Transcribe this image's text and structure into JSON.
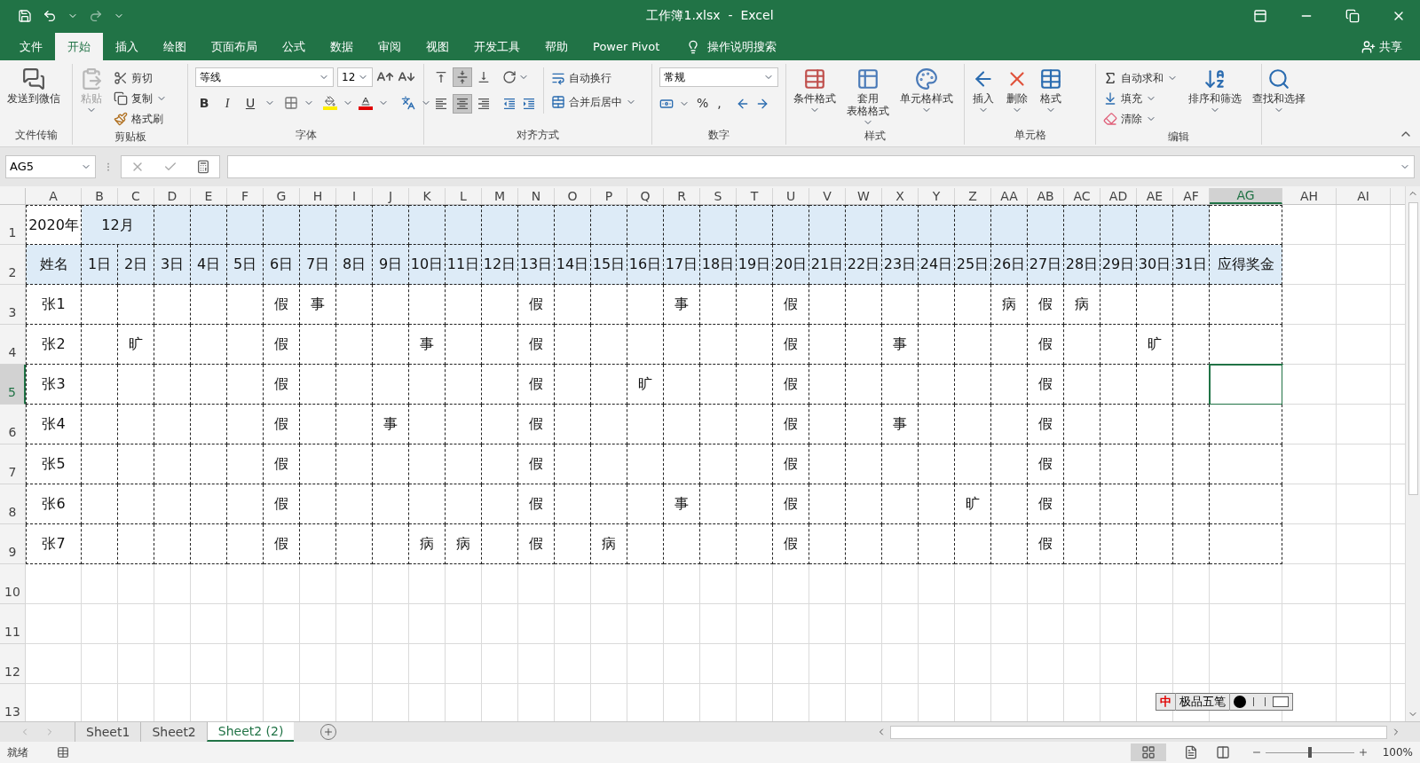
{
  "window": {
    "title": "工作簿1.xlsx  -  Excel"
  },
  "menu_tabs": [
    {
      "label": "文件",
      "selected": false
    },
    {
      "label": "开始",
      "selected": true
    },
    {
      "label": "插入",
      "selected": false
    },
    {
      "label": "绘图",
      "selected": false
    },
    {
      "label": "页面布局",
      "selected": false
    },
    {
      "label": "公式",
      "selected": false
    },
    {
      "label": "数据",
      "selected": false
    },
    {
      "label": "审阅",
      "selected": false
    },
    {
      "label": "视图",
      "selected": false
    },
    {
      "label": "开发工具",
      "selected": false
    },
    {
      "label": "帮助",
      "selected": false
    },
    {
      "label": "Power Pivot",
      "selected": false
    }
  ],
  "tell_me": "操作说明搜索",
  "share": "共享",
  "ribbon": {
    "send": {
      "label": "发送到微信",
      "group": "文件传输"
    },
    "clipboard": {
      "group": "剪贴板",
      "paste": {
        "label": "粘贴",
        "disabled": true
      },
      "items": [
        {
          "label": "剪切"
        },
        {
          "label": "复制"
        },
        {
          "label": "格式刷"
        }
      ]
    },
    "font": {
      "group": "字体",
      "name": "等线",
      "size": "12",
      "styles": [
        "B",
        "I",
        "U"
      ]
    },
    "alignment": {
      "group": "对齐方式",
      "vertical": [
        {
          "selected": false
        },
        {
          "selected": true
        },
        {
          "selected": false
        }
      ],
      "horizontal": [
        {
          "selected": false
        },
        {
          "selected": true
        },
        {
          "selected": false
        }
      ],
      "wrap": "自动换行",
      "merge": "合并后居中"
    },
    "number": {
      "group": "数字",
      "format": "常规",
      "symbols": [
        "%",
        ","
      ]
    },
    "styles": {
      "group": "样式",
      "items": [
        {
          "lines": [
            "条件格式"
          ]
        },
        {
          "lines": [
            "套用",
            "表格格式"
          ]
        },
        {
          "lines": [
            "单元格样式"
          ]
        }
      ]
    },
    "cells": {
      "group": "单元格",
      "items": [
        {
          "label": "插入"
        },
        {
          "label": "删除"
        },
        {
          "label": "格式"
        }
      ]
    },
    "editing": {
      "group": "编辑",
      "small": [
        {
          "label": "自动求和"
        },
        {
          "label": "填充"
        },
        {
          "label": "清除"
        }
      ],
      "large": [
        {
          "label": "排序和筛选"
        },
        {
          "label": "查找和选择"
        }
      ]
    }
  },
  "name_box": "AG5",
  "columns": [
    {
      "label": "A",
      "selected": false
    },
    {
      "label": "B",
      "selected": false
    },
    {
      "label": "C",
      "selected": false
    },
    {
      "label": "D",
      "selected": false
    },
    {
      "label": "E",
      "selected": false
    },
    {
      "label": "F",
      "selected": false
    },
    {
      "label": "G",
      "selected": false
    },
    {
      "label": "H",
      "selected": false
    },
    {
      "label": "I",
      "selected": false
    },
    {
      "label": "J",
      "selected": false
    },
    {
      "label": "K",
      "selected": false
    },
    {
      "label": "L",
      "selected": false
    },
    {
      "label": "M",
      "selected": false
    },
    {
      "label": "N",
      "selected": false
    },
    {
      "label": "O",
      "selected": false
    },
    {
      "label": "P",
      "selected": false
    },
    {
      "label": "Q",
      "selected": false
    },
    {
      "label": "R",
      "selected": false
    },
    {
      "label": "S",
      "selected": false
    },
    {
      "label": "T",
      "selected": false
    },
    {
      "label": "U",
      "selected": false
    },
    {
      "label": "V",
      "selected": false
    },
    {
      "label": "W",
      "selected": false
    },
    {
      "label": "X",
      "selected": false
    },
    {
      "label": "Y",
      "selected": false
    },
    {
      "label": "Z",
      "selected": false
    },
    {
      "label": "AA",
      "selected": false
    },
    {
      "label": "AB",
      "selected": false
    },
    {
      "label": "AC",
      "selected": false
    },
    {
      "label": "AD",
      "selected": false
    },
    {
      "label": "AE",
      "selected": false
    },
    {
      "label": "AF",
      "selected": false
    },
    {
      "label": "AG",
      "selected": true
    },
    {
      "label": "AH",
      "selected": false
    },
    {
      "label": "AI",
      "selected": false
    }
  ],
  "rows": [
    {
      "number": "1",
      "selected": false,
      "kind": "title",
      "cells": [
        {
          "text": "2020年",
          "shaded": false,
          "merged": false
        },
        {
          "text": "12月",
          "shaded": true,
          "merged": true
        },
        {
          "shaded": true,
          "merged": false
        },
        {
          "shaded": true,
          "merged": false
        },
        {
          "shaded": true,
          "merged": false
        },
        {
          "shaded": true,
          "merged": false
        },
        {
          "shaded": true,
          "merged": false
        },
        {
          "shaded": true,
          "merged": false
        },
        {
          "shaded": true,
          "merged": false
        },
        {
          "shaded": true,
          "merged": false
        },
        {
          "shaded": true,
          "merged": false
        },
        {
          "shaded": true,
          "merged": false
        },
        {
          "shaded": true,
          "merged": false
        },
        {
          "shaded": true,
          "merged": false
        },
        {
          "shaded": true,
          "merged": false
        },
        {
          "shaded": true,
          "merged": false
        },
        {
          "shaded": true,
          "merged": false
        },
        {
          "shaded": true,
          "merged": false
        },
        {
          "shaded": true,
          "merged": false
        },
        {
          "shaded": true,
          "merged": false
        },
        {
          "shaded": true,
          "merged": false
        },
        {
          "shaded": true,
          "merged": false
        },
        {
          "shaded": true,
          "merged": false
        },
        {
          "shaded": true,
          "merged": false
        },
        {
          "shaded": true,
          "merged": false
        },
        {
          "shaded": true,
          "merged": false
        },
        {
          "shaded": true,
          "merged": false
        },
        {
          "shaded": true,
          "merged": false
        },
        {
          "shaded": true,
          "merged": false
        },
        {
          "shaded": true,
          "merged": false
        },
        {
          "shaded": true,
          "merged": false
        },
        {
          "shaded": false,
          "merged": false
        }
      ]
    },
    {
      "number": "2",
      "selected": false,
      "kind": "table",
      "shaded": true,
      "cells": [
        {
          "text": "姓名"
        },
        {
          "text": "1日"
        },
        {
          "text": "2日"
        },
        {
          "text": "3日"
        },
        {
          "text": "4日"
        },
        {
          "text": "5日"
        },
        {
          "text": "6日"
        },
        {
          "text": "7日"
        },
        {
          "text": "8日"
        },
        {
          "text": "9日"
        },
        {
          "text": "10日"
        },
        {
          "text": "11日"
        },
        {
          "text": "12日"
        },
        {
          "text": "13日"
        },
        {
          "text": "14日"
        },
        {
          "text": "15日"
        },
        {
          "text": "16日"
        },
        {
          "text": "17日"
        },
        {
          "text": "18日"
        },
        {
          "text": "19日"
        },
        {
          "text": "20日"
        },
        {
          "text": "21日"
        },
        {
          "text": "22日"
        },
        {
          "text": "23日"
        },
        {
          "text": "24日"
        },
        {
          "text": "25日"
        },
        {
          "text": "26日"
        },
        {
          "text": "27日"
        },
        {
          "text": "28日"
        },
        {
          "text": "29日"
        },
        {
          "text": "30日"
        },
        {
          "text": "31日"
        },
        {
          "text": "应得奖金"
        }
      ]
    },
    {
      "number": "3",
      "selected": false,
      "kind": "table",
      "shaded": false,
      "cells": [
        {
          "text": "张1"
        },
        {},
        {},
        {},
        {},
        {},
        {
          "text": "假"
        },
        {
          "text": "事"
        },
        {},
        {},
        {},
        {},
        {},
        {
          "text": "假"
        },
        {},
        {},
        {},
        {
          "text": "事"
        },
        {},
        {},
        {
          "text": "假"
        },
        {},
        {},
        {},
        {},
        {},
        {
          "text": "病"
        },
        {
          "text": "假"
        },
        {
          "text": "病"
        },
        {},
        {},
        {},
        {}
      ]
    },
    {
      "number": "4",
      "selected": false,
      "kind": "table",
      "shaded": false,
      "cells": [
        {
          "text": "张2"
        },
        {},
        {
          "text": "旷"
        },
        {},
        {},
        {},
        {
          "text": "假"
        },
        {},
        {},
        {},
        {
          "text": "事"
        },
        {},
        {},
        {
          "text": "假"
        },
        {},
        {},
        {},
        {},
        {},
        {},
        {
          "text": "假"
        },
        {},
        {},
        {
          "text": "事"
        },
        {},
        {},
        {},
        {
          "text": "假"
        },
        {},
        {},
        {
          "text": "旷"
        },
        {},
        {}
      ]
    },
    {
      "number": "5",
      "selected": true,
      "kind": "table",
      "shaded": false,
      "cells": [
        {
          "text": "张3"
        },
        {},
        {},
        {},
        {},
        {},
        {
          "text": "假"
        },
        {},
        {},
        {},
        {},
        {},
        {},
        {
          "text": "假"
        },
        {},
        {},
        {
          "text": "旷"
        },
        {},
        {},
        {},
        {
          "text": "假"
        },
        {},
        {},
        {},
        {},
        {},
        {},
        {
          "text": "假"
        },
        {},
        {},
        {},
        {},
        {}
      ]
    },
    {
      "number": "6",
      "selected": false,
      "kind": "table",
      "shaded": false,
      "cells": [
        {
          "text": "张4"
        },
        {},
        {},
        {},
        {},
        {},
        {
          "text": "假"
        },
        {},
        {},
        {
          "text": "事"
        },
        {},
        {},
        {},
        {
          "text": "假"
        },
        {},
        {},
        {},
        {},
        {},
        {},
        {
          "text": "假"
        },
        {},
        {},
        {
          "text": "事"
        },
        {},
        {},
        {},
        {
          "text": "假"
        },
        {},
        {},
        {},
        {},
        {}
      ]
    },
    {
      "number": "7",
      "selected": false,
      "kind": "table",
      "shaded": false,
      "cells": [
        {
          "text": "张5"
        },
        {},
        {},
        {},
        {},
        {},
        {
          "text": "假"
        },
        {},
        {},
        {},
        {},
        {},
        {},
        {
          "text": "假"
        },
        {},
        {},
        {},
        {},
        {},
        {},
        {
          "text": "假"
        },
        {},
        {},
        {},
        {},
        {},
        {},
        {
          "text": "假"
        },
        {},
        {},
        {},
        {},
        {}
      ]
    },
    {
      "number": "8",
      "selected": false,
      "kind": "table",
      "shaded": false,
      "cells": [
        {
          "text": "张6"
        },
        {},
        {},
        {},
        {},
        {},
        {
          "text": "假"
        },
        {},
        {},
        {},
        {},
        {},
        {},
        {
          "text": "假"
        },
        {},
        {},
        {},
        {
          "text": "事"
        },
        {},
        {},
        {
          "text": "假"
        },
        {},
        {},
        {},
        {},
        {
          "text": "旷"
        },
        {},
        {
          "text": "假"
        },
        {},
        {},
        {},
        {},
        {}
      ]
    },
    {
      "number": "9",
      "selected": false,
      "kind": "table",
      "shaded": false,
      "cells": [
        {
          "text": "张7"
        },
        {},
        {},
        {},
        {},
        {},
        {
          "text": "假"
        },
        {},
        {},
        {},
        {
          "text": "病"
        },
        {
          "text": "病"
        },
        {},
        {
          "text": "假"
        },
        {},
        {
          "text": "病"
        },
        {},
        {},
        {},
        {},
        {
          "text": "假"
        },
        {},
        {},
        {},
        {},
        {},
        {},
        {
          "text": "假"
        },
        {},
        {},
        {},
        {},
        {}
      ]
    },
    {
      "number": "10",
      "selected": false,
      "kind": "blank"
    },
    {
      "number": "11",
      "selected": false,
      "kind": "blank"
    },
    {
      "number": "12",
      "selected": false,
      "kind": "blank"
    },
    {
      "number": "13",
      "selected": false,
      "kind": "blank"
    }
  ],
  "sheet_tabs": [
    {
      "label": "Sheet1",
      "selected": false
    },
    {
      "label": "Sheet2",
      "selected": false
    },
    {
      "label": "Sheet2 (2)",
      "selected": true
    }
  ],
  "ime_bar": {
    "mode": "中",
    "label": "极品五笔"
  },
  "status_bar": {
    "status": "就绪",
    "zoom": {
      "level": 0.5
    },
    "zoom_label": "100%"
  }
}
